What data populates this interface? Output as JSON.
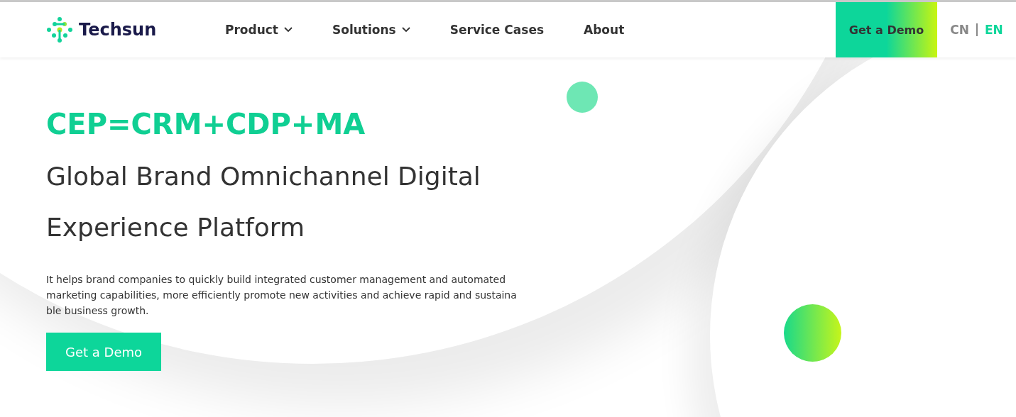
{
  "header": {
    "brand": "Techsun",
    "nav": [
      {
        "label": "Product",
        "dropdown": true
      },
      {
        "label": "Solutions",
        "dropdown": true
      },
      {
        "label": "Service Cases",
        "dropdown": false
      },
      {
        "label": "About",
        "dropdown": false
      }
    ],
    "cta": "Get a Demo",
    "languages": [
      {
        "label": "CN",
        "selected": false
      },
      {
        "label": "EN",
        "selected": true
      }
    ]
  },
  "hero": {
    "formula": "CEP=CRM+CDP+MA",
    "title_lines": [
      "Global Brand Omnichannel Digital",
      "Experience Platform"
    ],
    "description": "It helps brand companies to quickly build integrated customer management and automated marketing capabilities, more efficiently promote new activities and achieve rapid and sustainable business growth.",
    "button": "Get a Demo"
  }
}
